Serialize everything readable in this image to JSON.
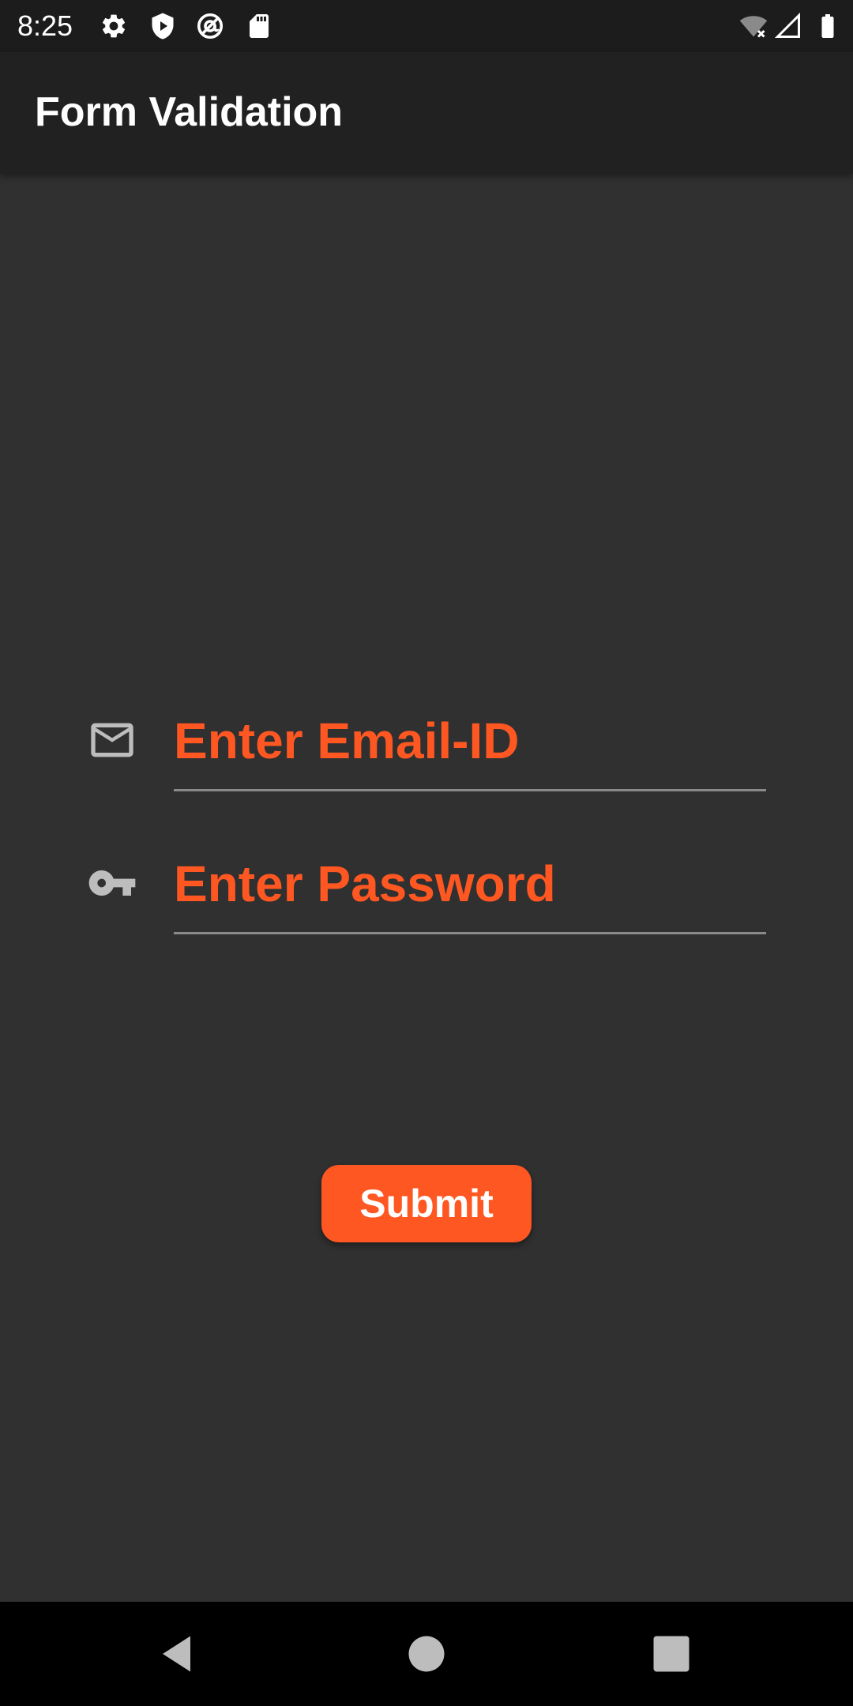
{
  "status_bar": {
    "time": "8:25",
    "left_icons": [
      "gear-icon",
      "shield-play-icon",
      "at-sign-icon",
      "sd-card-icon"
    ],
    "right_icons": [
      "wifi-off-icon",
      "cell-signal-icon",
      "battery-icon"
    ]
  },
  "app_bar": {
    "title": "Form Validation"
  },
  "form": {
    "email": {
      "icon": "mail-icon",
      "placeholder": "Enter Email-ID",
      "value": ""
    },
    "password": {
      "icon": "key-icon",
      "placeholder": "Enter Password",
      "value": ""
    },
    "submit_label": "Submit"
  },
  "nav_bar": {
    "buttons": [
      "back-icon",
      "home-icon",
      "recents-icon"
    ]
  },
  "colors": {
    "accent": "#FF5722",
    "background": "#303030",
    "app_bar": "#212121",
    "status_bar": "#1c1c1c",
    "underline": "#8a8a8a"
  }
}
